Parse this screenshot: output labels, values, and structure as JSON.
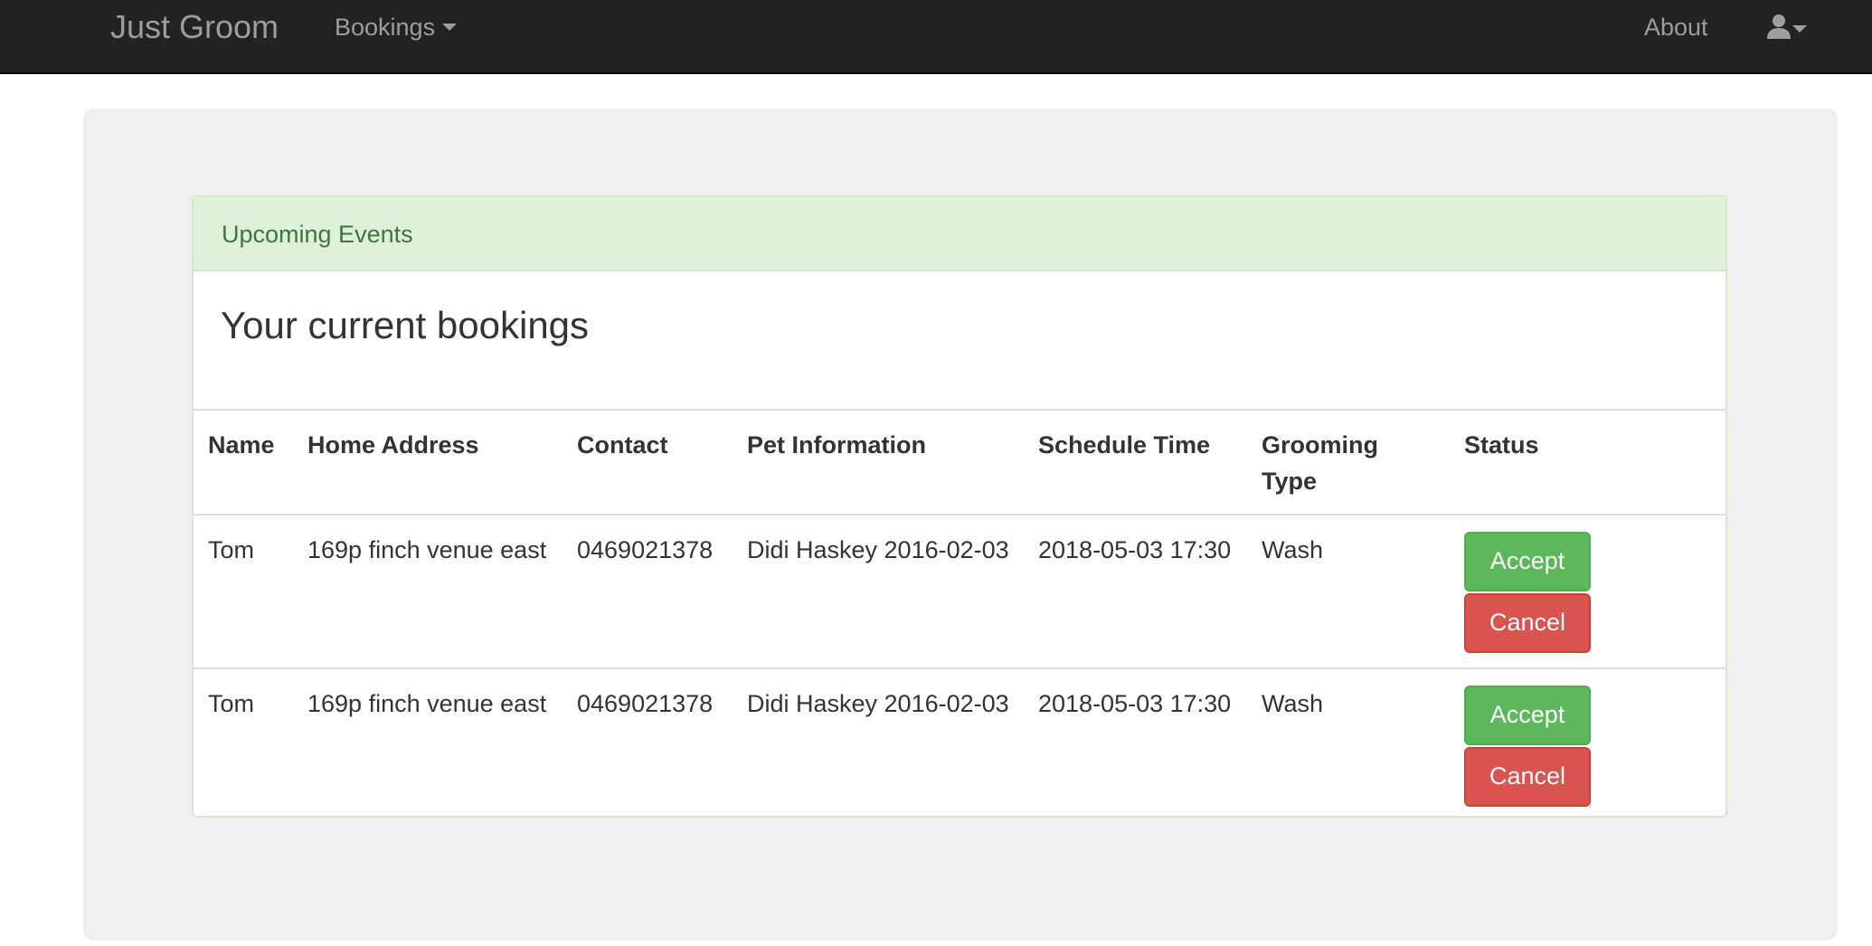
{
  "navbar": {
    "brand": "Just Groom",
    "bookings_label": "Bookings",
    "about_label": "About",
    "user_icon": "user-icon"
  },
  "panel": {
    "heading": "Upcoming Events",
    "title": "Your current bookings"
  },
  "table": {
    "headers": {
      "name": "Name",
      "address": "Home Address",
      "contact": "Contact",
      "pet": "Pet Information",
      "schedule": "Schedule Time",
      "grooming": "Grooming Type",
      "status": "Status"
    },
    "rows": [
      {
        "name": "Tom",
        "address": "169p finch venue east",
        "contact": "0469021378",
        "pet": "Didi Haskey 2016-02-03",
        "schedule": "2018-05-03 17:30",
        "grooming": "Wash",
        "accept_label": "Accept",
        "cancel_label": "Cancel"
      },
      {
        "name": "Tom",
        "address": "169p finch venue east",
        "contact": "0469021378",
        "pet": "Didi Haskey 2016-02-03",
        "schedule": "2018-05-03 17:30",
        "grooming": "Wash",
        "accept_label": "Accept",
        "cancel_label": "Cancel"
      }
    ]
  },
  "colors": {
    "navbar_bg": "#222222",
    "nav_text": "#9d9d9d",
    "jumbotron_bg": "#eeeeee",
    "panel_heading_bg": "#dff0d8",
    "panel_heading_text": "#3c763d",
    "accept_button": "#5cb85c",
    "cancel_button": "#d9534f"
  }
}
